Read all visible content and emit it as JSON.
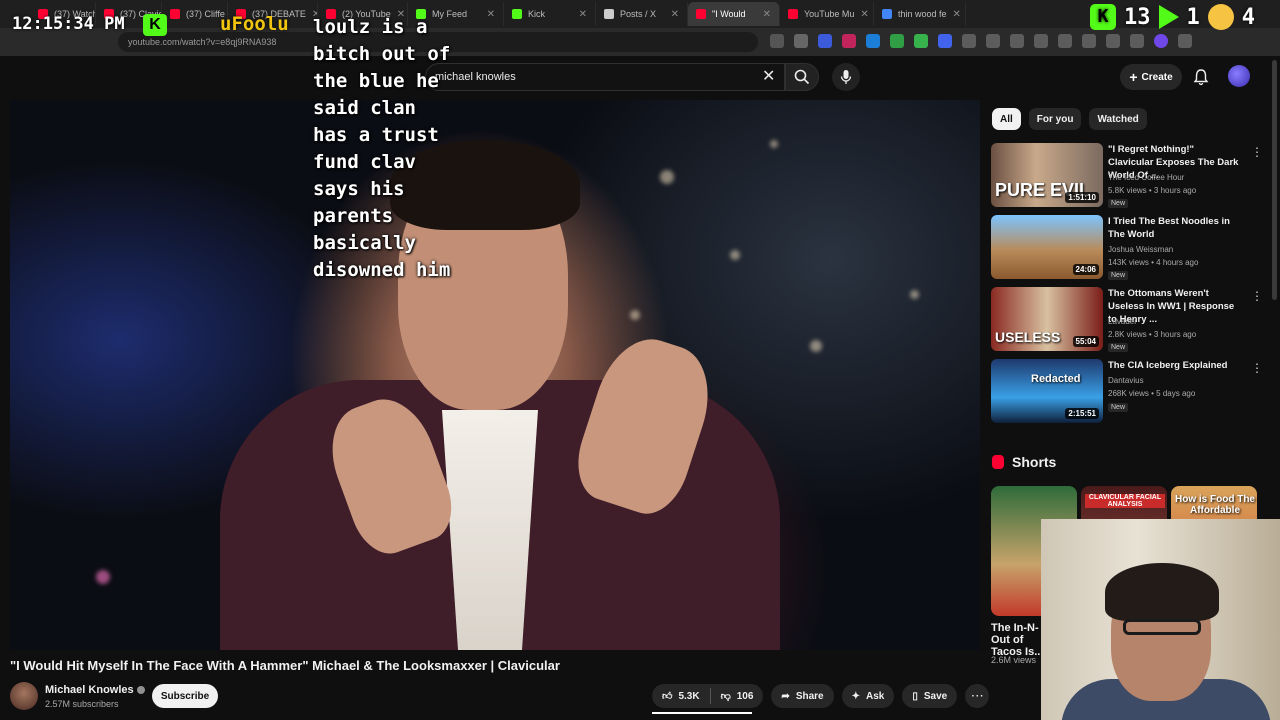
{
  "browser": {
    "tabs": [
      {
        "label": "(37) Watch l",
        "color": "#ff0033"
      },
      {
        "label": "(37) Clavic",
        "color": "#ff0033"
      },
      {
        "label": "(37) Cliffe",
        "color": "#ff0033"
      },
      {
        "label": "(37) DEBATE",
        "color": "#ff0033"
      },
      {
        "label": "(2) YouTube",
        "color": "#ff0033"
      },
      {
        "label": "My Feed",
        "color": "#53fc18"
      },
      {
        "label": "Kick",
        "color": "#53fc18"
      },
      {
        "label": "Posts / X",
        "color": "#cccccc"
      },
      {
        "label": "\"I Would",
        "color": "#ff0033"
      },
      {
        "label": "YouTube Mu",
        "color": "#ff0033"
      },
      {
        "label": "thin wood fe",
        "color": "#4285f4"
      }
    ],
    "url": "youtube.com/watch?v=e8qj9RNA938"
  },
  "stream_overlay": {
    "clock": "12:15:34 PM",
    "username": "uFoolu",
    "message": "loulz is a\nbitch out of the blue he said clan\nhas a trust fund clav says his\nparents basically disowned him",
    "count_a": "13",
    "count_b": "1",
    "count_c": "4"
  },
  "youtube": {
    "search": {
      "value": "michael knowles"
    },
    "create_label": "Create"
  },
  "video": {
    "title": "\"I Would Hit Myself In The Face With A Hammer\" Michael & The Looksmaxxer | Clavicular",
    "channel": "Michael Knowles",
    "subscribers": "2.57M subscribers",
    "subscribe_label": "Subscribe",
    "likes": "5.3K",
    "dislikes": "106",
    "share_label": "Share",
    "ask_label": "Ask",
    "save_label": "Save"
  },
  "sidebar": {
    "chips": [
      "All",
      "For you",
      "Watched"
    ],
    "recommendations": [
      {
        "title": "\"I Regret Nothing!\" Clavicular Exposes The Dark World Of ...",
        "channel": "The Iced Coffee Hour",
        "meta": "5.8K views • 3 hours ago",
        "badge": "New",
        "duration": "1:51:10",
        "thumb_text": "PURE EVIL"
      },
      {
        "title": "I Tried The Best Noodles in The World",
        "channel": "Joshua Weissman",
        "meta": "143K views • 4 hours ago",
        "badge": "New",
        "duration": "24:06",
        "thumb_text": ""
      },
      {
        "title": "The Ottomans Weren't Useless In WW1 | Response to Henry ...",
        "channel": "Lavader",
        "meta": "2.8K views • 3 hours ago",
        "badge": "New",
        "duration": "55:04",
        "thumb_text": "USELESS"
      },
      {
        "title": "The CIA Iceberg Explained",
        "channel": "Dantavius",
        "meta": "268K views • 5 days ago",
        "badge": "New",
        "duration": "2:15:51",
        "thumb_text": "Redacted"
      }
    ],
    "shorts_title": "Shorts",
    "shorts": [
      {
        "caption": "The In-N-Out of Tacos Is...",
        "views": "2.6M views",
        "label": ""
      },
      {
        "caption": "",
        "views": "",
        "label": "CLAVICULAR FACIAL ANALYSIS"
      },
      {
        "caption": "",
        "views": "",
        "label": "How is Food The Affordable"
      }
    ]
  }
}
